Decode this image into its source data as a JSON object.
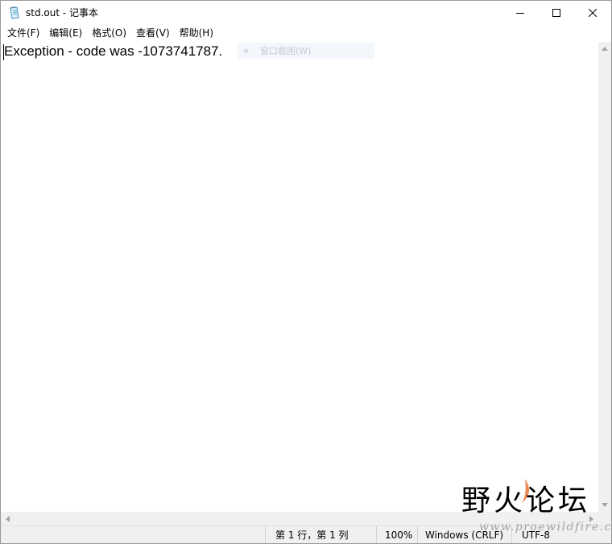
{
  "window": {
    "title": "std.out - 记事本",
    "title_icon": "notepad-icon",
    "controls": {
      "minimize_icon": "minimize-icon",
      "maximize_icon": "maximize-icon",
      "close_icon": "close-icon"
    }
  },
  "menu": {
    "items": [
      {
        "label": "文件(F)"
      },
      {
        "label": "编辑(E)"
      },
      {
        "label": "格式(O)"
      },
      {
        "label": "查看(V)"
      },
      {
        "label": "帮助(H)"
      }
    ]
  },
  "editor": {
    "content": "Exception - code was -1073741787.",
    "ghost_tooltip": "窗口截图(W)"
  },
  "status": {
    "position": "第 1 行，第 1 列",
    "zoom": "100%",
    "line_ending": "Windows (CRLF)",
    "encoding": "UTF-8"
  },
  "watermark": {
    "brand": "野火论坛",
    "url": "www.proewildfire.cn"
  },
  "colors": {
    "window_bg": "#ffffff",
    "chrome_bg": "#f0f0f0",
    "border": "#9a9a9a",
    "watermark_accent": "#eb7a3c"
  }
}
